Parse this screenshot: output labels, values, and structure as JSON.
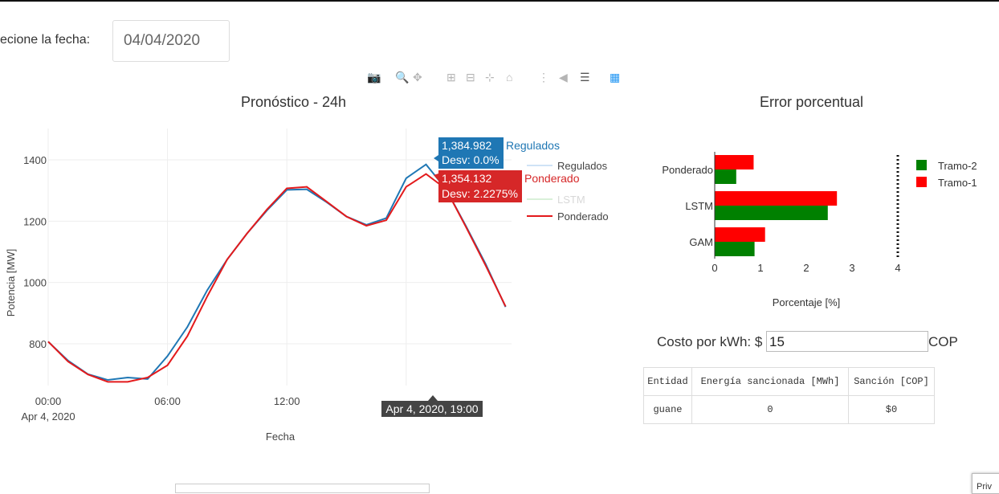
{
  "date_picker": {
    "label": "ecione la fecha:",
    "value": "04/04/2020"
  },
  "modebar": {
    "icons": [
      "camera-icon",
      "zoom-icon",
      "pan-icon",
      "zoom-in-icon",
      "zoom-out-icon",
      "autoscale-icon",
      "reset-axes-icon",
      "spike-lines-icon",
      "hover-closest-icon",
      "hover-compare-icon",
      "plotly-logo-icon"
    ]
  },
  "forecast_chart": {
    "title": "Pronóstico - 24h",
    "xlabel": "Fecha",
    "ylabel": "Potencia [MW]",
    "x_ticks": [
      "00:00",
      "06:00",
      "12:00",
      "18:00"
    ],
    "x_tick_sub": "Apr 4, 2020",
    "y_ticks": [
      "800",
      "1000",
      "1200",
      "1400"
    ],
    "legend": [
      "Regulados",
      "LSTM",
      "Ponderado"
    ],
    "hover": {
      "regulados_box": [
        "1,384.982",
        "Desv: 0.0%"
      ],
      "regulados_name": "Regulados",
      "ponderado_box": [
        "1,354.132",
        "Desv: 2.2275%"
      ],
      "ponderado_name": "Ponderado",
      "x_label": "Apr 4, 2020, 19:00"
    }
  },
  "error_chart": {
    "title": "Error porcentual",
    "xlabel": "Porcentaje [%]",
    "legend": [
      "Tramo-2",
      "Tramo-1"
    ],
    "x_ticks": [
      "0",
      "1",
      "2",
      "3",
      "4"
    ]
  },
  "cost": {
    "label": "Costo por kWh: $",
    "value": "15",
    "unit": "COP"
  },
  "sanction_table": {
    "headers": [
      "Entidad",
      "Energía sancionada [MWh]",
      "Sanción [COP]"
    ],
    "rows": [
      [
        "guane",
        "0",
        "$0"
      ]
    ]
  },
  "corner_text": "Priv",
  "colors": {
    "regulados": "#1f77b4",
    "ponderado": "#e31a1c",
    "tramo2": "#008000",
    "tramo1": "#ff0000"
  },
  "chart_data": [
    {
      "type": "line",
      "title": "Pronóstico - 24h",
      "xlabel": "Fecha",
      "ylabel": "Potencia [MW]",
      "x": [
        "00:00",
        "01:00",
        "02:00",
        "03:00",
        "04:00",
        "05:00",
        "06:00",
        "07:00",
        "08:00",
        "09:00",
        "10:00",
        "11:00",
        "12:00",
        "13:00",
        "14:00",
        "15:00",
        "16:00",
        "17:00",
        "18:00",
        "19:00",
        "20:00",
        "21:00",
        "22:00",
        "23:00"
      ],
      "ylim": [
        700,
        1450
      ],
      "series": [
        {
          "name": "Regulados",
          "values": [
            807,
            745,
            701,
            682,
            690,
            685,
            760,
            855,
            975,
            1075,
            1160,
            1235,
            1302,
            1304,
            1262,
            1215,
            1188,
            1210,
            1340,
            1385,
            1305,
            1185,
            1060,
            920
          ]
        },
        {
          "name": "LSTM",
          "values": []
        },
        {
          "name": "Ponderado",
          "values": [
            807,
            742,
            700,
            676,
            676,
            690,
            730,
            825,
            955,
            1075,
            1160,
            1238,
            1307,
            1312,
            1264,
            1215,
            1185,
            1203,
            1312,
            1354,
            1305,
            1182,
            1055,
            922
          ]
        }
      ]
    },
    {
      "type": "bar",
      "orientation": "horizontal",
      "title": "Error porcentual",
      "xlabel": "Porcentaje [%]",
      "categories": [
        "Ponderado",
        "LSTM",
        "GAM"
      ],
      "xlim": [
        0,
        4
      ],
      "series": [
        {
          "name": "Tramo-2",
          "values": [
            0.47,
            2.47,
            0.87
          ]
        },
        {
          "name": "Tramo-1",
          "values": [
            0.85,
            2.67,
            1.1
          ]
        }
      ]
    }
  ]
}
